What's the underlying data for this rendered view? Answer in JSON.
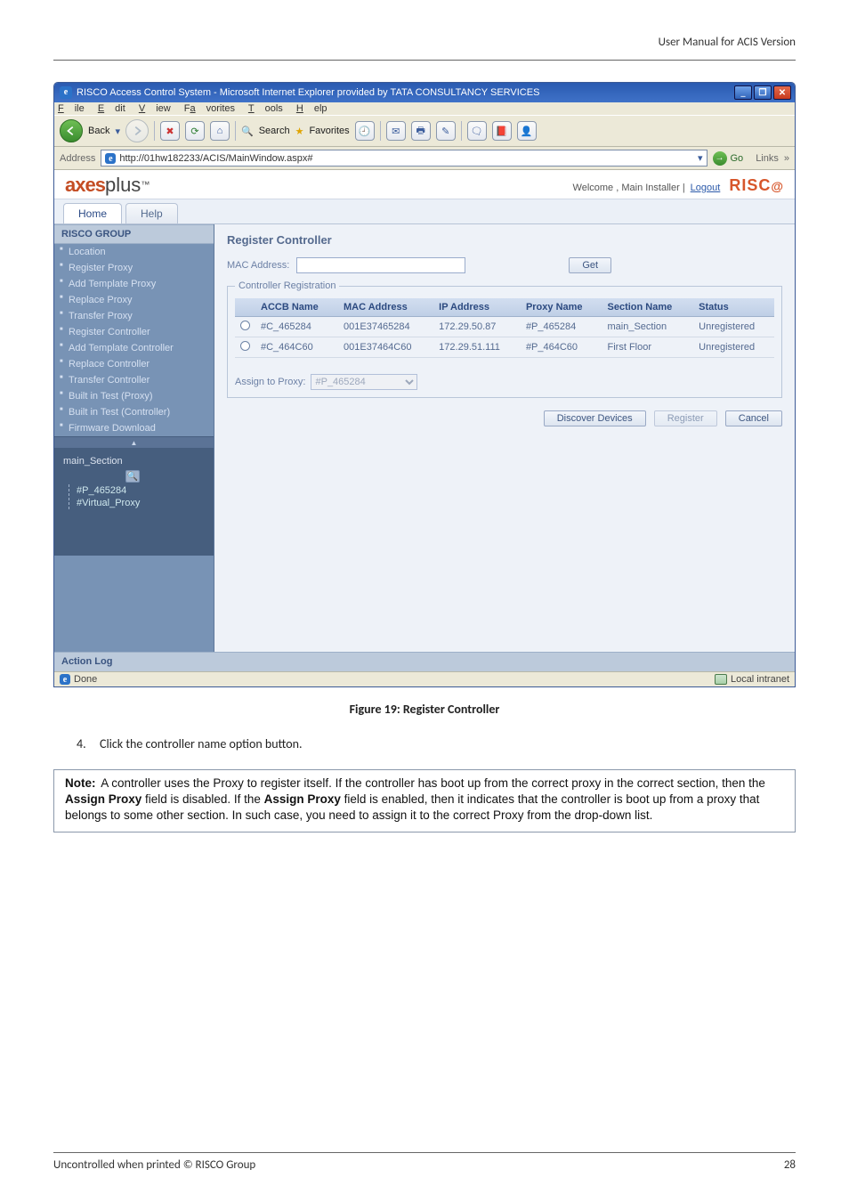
{
  "doc": {
    "running_head": "User Manual for ACIS Version",
    "caption": "Figure 19: Register Controller",
    "step_number": "4.",
    "step_text": "Click the controller name option button.",
    "note_lead": "Note:",
    "note_body": "A controller uses the Proxy to register itself. If the controller has boot up from the correct proxy in the correct section, then the <b>Assign Proxy</b> field is disabled. If the <b>Assign Proxy</b> field is enabled, then it indicates that the controller is boot up from a proxy that belongs to some other section. In such case, you need to assign it to the correct Proxy from the drop-down list.",
    "footer_left": "Uncontrolled when printed © RISCO Group",
    "footer_right": "28"
  },
  "window": {
    "title": "RISCO Access Control System - Microsoft Internet Explorer provided by TATA CONSULTANCY SERVICES",
    "menus": [
      "File",
      "Edit",
      "View",
      "Favorites",
      "Tools",
      "Help"
    ],
    "back_label": "Back",
    "search_label": "Search",
    "favorites_label": "Favorites",
    "address_label": "Address",
    "address_value": "http://01hw182233/ACIS/MainWindow.aspx#",
    "go_label": "Go",
    "links_label": "Links",
    "status_left": "Done",
    "status_right": "Local intranet"
  },
  "app": {
    "brand_axes": "axes",
    "brand_plus": "plus",
    "welcome": "Welcome ,  Main Installer  |",
    "logout": "Logout",
    "risco": "RISC",
    "tabs": {
      "home": "Home",
      "help": "Help"
    },
    "sidebar": {
      "group": "RISCO GROUP",
      "items_a": [
        "Location",
        "Register Proxy",
        "Add Template Proxy",
        "Replace Proxy",
        "Transfer Proxy"
      ],
      "items_b": [
        "Register Controller",
        "Add Template Controller",
        "Replace Controller",
        "Transfer Controller"
      ],
      "items_c": [
        "Built in Test (Proxy)",
        "Built in Test (Controller)",
        "Firmware Download"
      ],
      "tree_root": "main_Section",
      "tree_children": [
        "#P_465284",
        "#Virtual_Proxy"
      ]
    },
    "content": {
      "heading": "Register Controller",
      "mac_label": "MAC Address:",
      "get_label": "Get",
      "legend": "Controller Registration",
      "columns": [
        "",
        "ACCB Name",
        "MAC Address",
        "IP Address",
        "Proxy Name",
        "Section Name",
        "Status"
      ],
      "rows": [
        {
          "r0": "",
          "accb": "#C_465284",
          "mac": "001E37465284",
          "ip": "172.29.50.87",
          "proxy": "#P_465284",
          "section": "main_Section",
          "status": "Unregistered"
        },
        {
          "r0": "",
          "accb": "#C_464C60",
          "mac": "001E37464C60",
          "ip": "172.29.51.111",
          "proxy": "#P_464C60",
          "section": "First Floor",
          "status": "Unregistered"
        }
      ],
      "assign_label": "Assign to Proxy:",
      "assign_selected": "#P_465284",
      "btn_discover": "Discover Devices",
      "btn_register": "Register",
      "btn_cancel": "Cancel",
      "action_log": "Action Log"
    }
  }
}
